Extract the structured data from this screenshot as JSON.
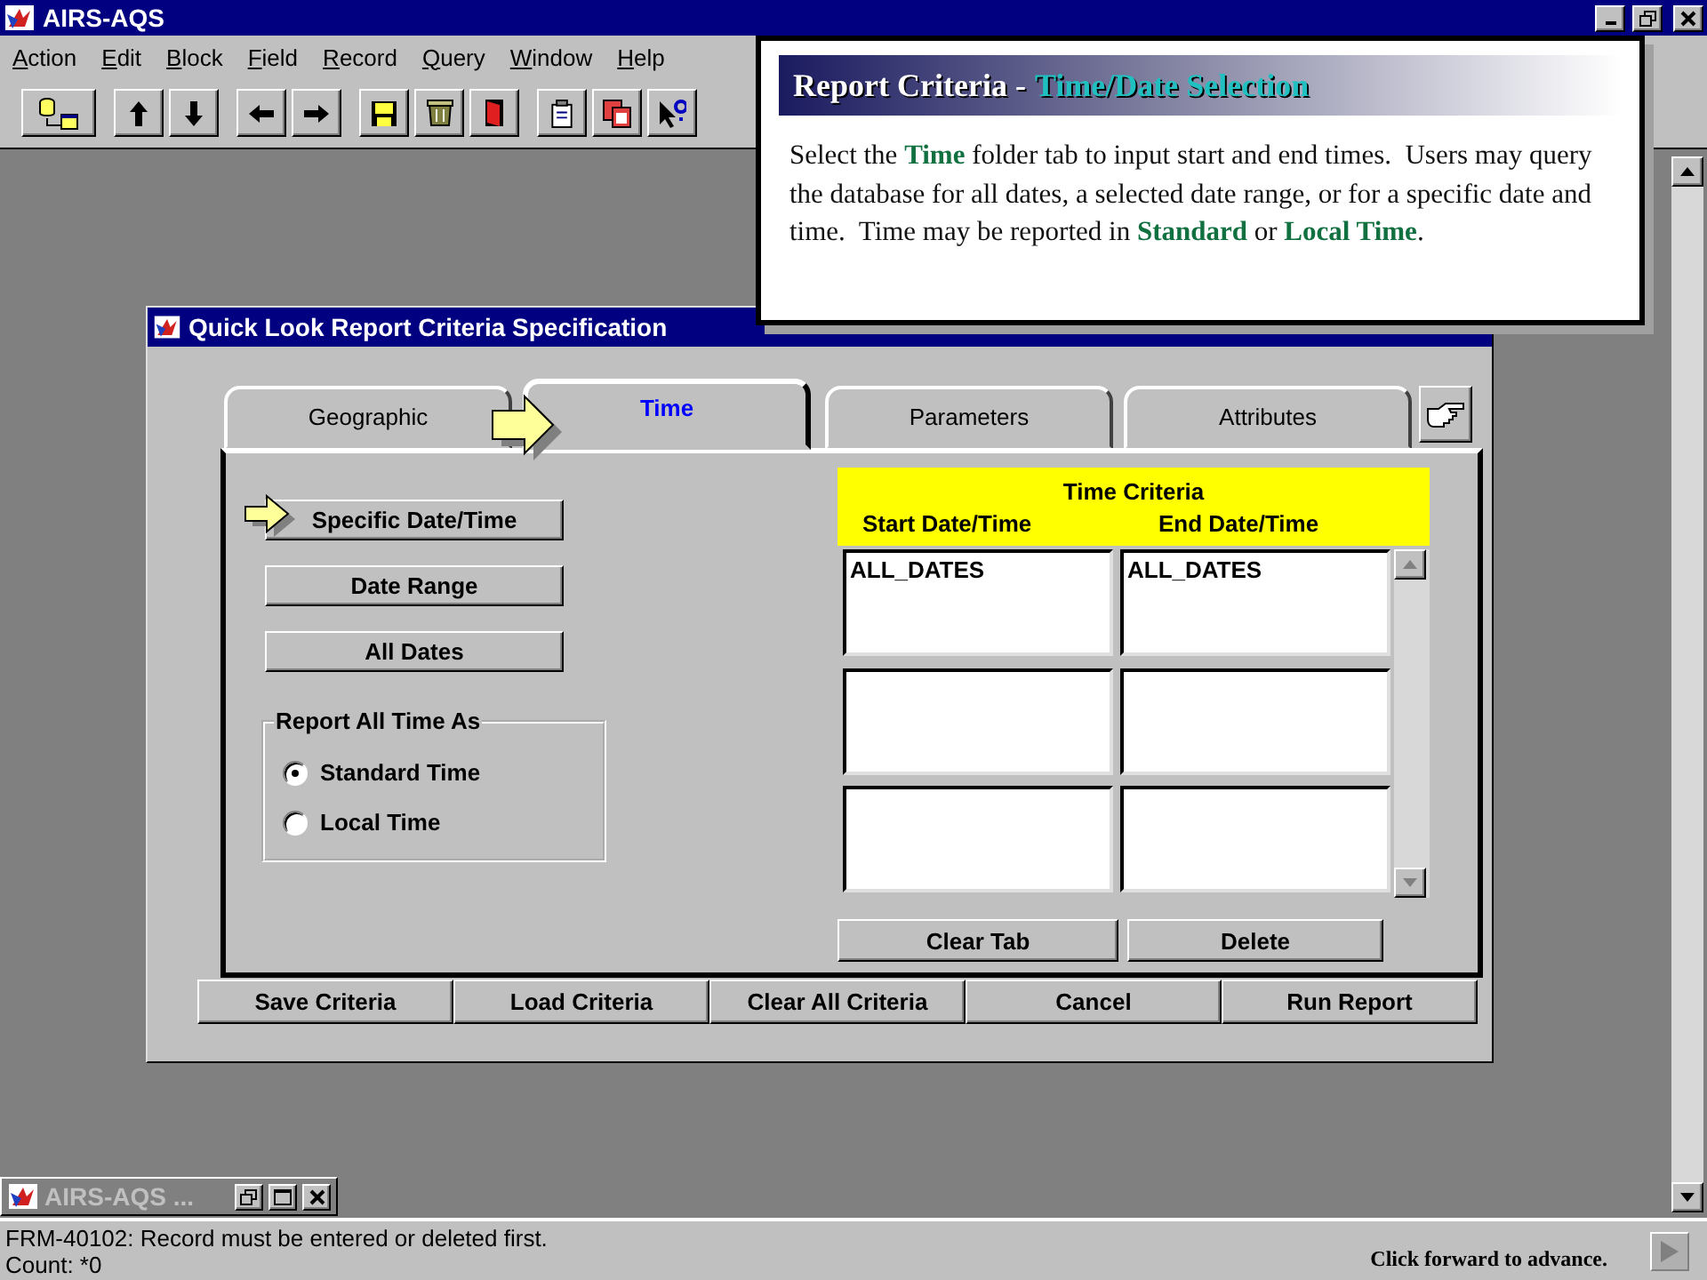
{
  "app": {
    "title": "AIRS-AQS"
  },
  "menu": [
    "Action",
    "Edit",
    "Block",
    "Field",
    "Record",
    "Query",
    "Window",
    "Help"
  ],
  "callout": {
    "title": "Report Criteria -",
    "subtitle": "Time/Date Selection",
    "text": "Select the **Time** folder tab to input start and end times.  Users may query the database for all dates, a selected date range, or for a specific date and time.  Time may be reported in **Standard** or **Local Time**."
  },
  "dialog": {
    "title": "Quick Look Report Criteria Specification",
    "tabs": [
      {
        "label": "Geographic",
        "selected": false
      },
      {
        "label": "Time",
        "selected": true
      },
      {
        "label": "Parameters",
        "selected": false
      },
      {
        "label": "Attributes",
        "selected": false
      }
    ],
    "date_buttons": [
      {
        "label": "Specific Date/Time",
        "selected": true
      },
      {
        "label": "Date Range",
        "selected": false
      },
      {
        "label": "All Dates",
        "selected": false
      }
    ],
    "time_group": {
      "title": "Report All Time As",
      "options": [
        {
          "label": "Standard Time",
          "selected": true
        },
        {
          "label": "Local Time",
          "selected": false
        }
      ]
    },
    "grid": {
      "title": "Time Criteria",
      "columns": [
        "Start Date/Time",
        "End Date/Time"
      ],
      "rows": [
        [
          "ALL_DATES",
          "ALL_DATES"
        ],
        [
          null,
          null
        ],
        [
          null,
          null
        ]
      ]
    },
    "grid_buttons": [
      "Clear Tab",
      "Delete"
    ],
    "footer_buttons": [
      "Save Criteria",
      "Load Criteria",
      "Clear All Criteria",
      "Cancel",
      "Run Report"
    ]
  },
  "minimized_window": {
    "title": "AIRS-AQS ..."
  },
  "status_bar": {
    "message": "FRM-40102: Record must be entered or deleted first.",
    "count": "Count: *0",
    "hint": "Click forward to advance."
  }
}
